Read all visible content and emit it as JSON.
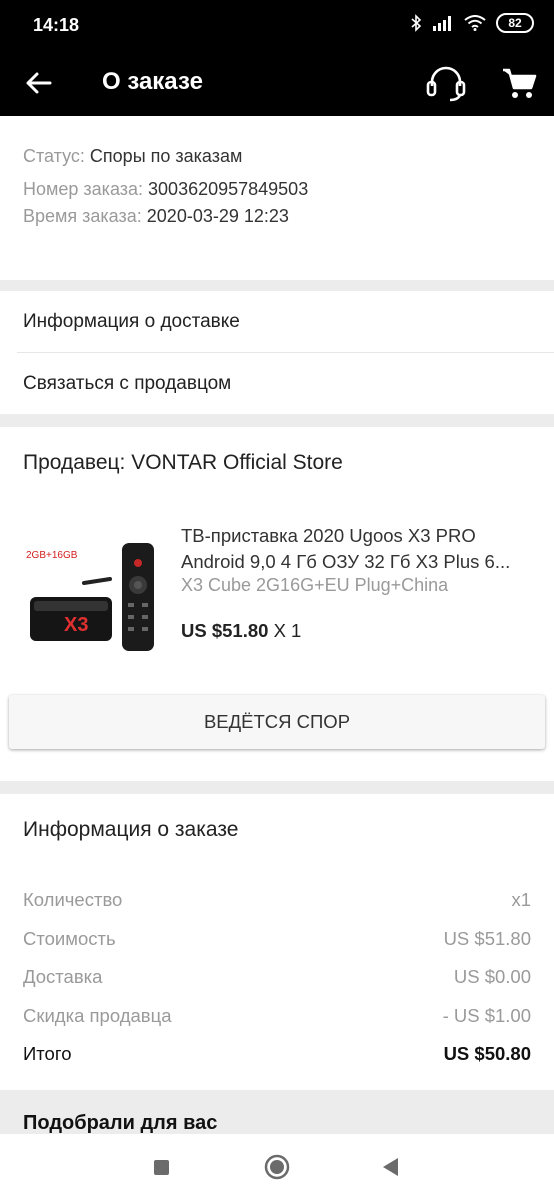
{
  "status_bar": {
    "time": "14:18",
    "battery": "82"
  },
  "header": {
    "title": "О заказе",
    "icons": [
      "back-arrow-icon",
      "headset-icon",
      "cart-icon"
    ]
  },
  "order": {
    "status_label": "Статус:",
    "status_value": "Споры по заказам",
    "number_label": "Номер заказа:",
    "number_value": "3003620957849503",
    "time_label": "Время заказа:",
    "time_value": "2020-03-29 12:23"
  },
  "links": {
    "delivery": "Информация о доставке",
    "contact_seller": "Связаться с продавцом"
  },
  "seller": {
    "title": "Продавец: VONTAR Official Store",
    "product": {
      "title_line1": "ТВ-приставка 2020 Ugoos X3 PRO",
      "title_line2": "Android 9,0 4 Гб ОЗУ 32 Гб X3 Plus 6...",
      "variant": "X3 Cube 2G16G+EU Plug+China",
      "price": "US $51.80",
      "quantity": "X 1",
      "image_text": "2GB+16GB"
    },
    "dispute_button": "ВЕДЁТСЯ СПОР"
  },
  "order_info": {
    "title": "Информация о заказе",
    "rows": [
      {
        "label": "Количество",
        "value": "x1"
      },
      {
        "label": "Стоимость",
        "value": "US $51.80"
      },
      {
        "label": "Доставка",
        "value": "US $0.00"
      },
      {
        "label": "Скидка продавца",
        "value": "- US $1.00"
      },
      {
        "label": "Итого",
        "value": "US $50.80"
      }
    ]
  },
  "recommend": {
    "title": "Подобрали для вас"
  },
  "colors": {
    "bar": "#000000",
    "background": "#ececec",
    "muted_text": "#9a9a9a"
  }
}
